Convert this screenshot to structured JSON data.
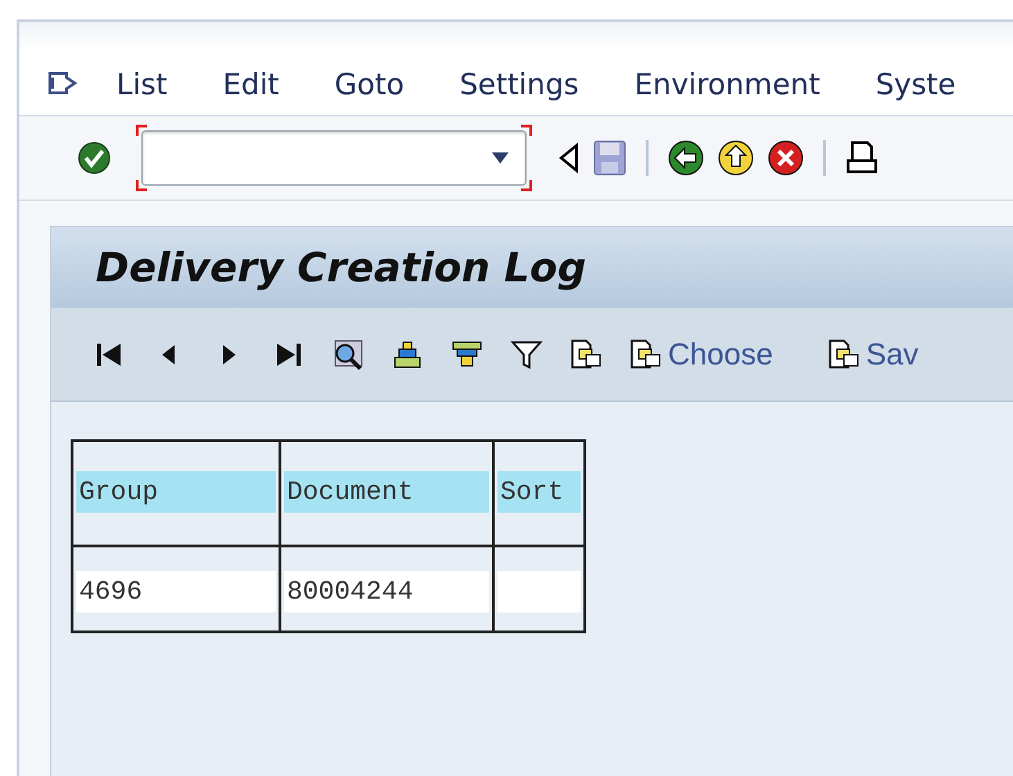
{
  "menu": [
    {
      "label": "List"
    },
    {
      "label": "Edit"
    },
    {
      "label": "Goto"
    },
    {
      "label": "Settings"
    },
    {
      "label": "Environment"
    },
    {
      "label": "Syste"
    }
  ],
  "screen": {
    "title": "Delivery Creation Log"
  },
  "app_toolbar": [
    {
      "kind": "first"
    },
    {
      "kind": "previous"
    },
    {
      "kind": "next"
    },
    {
      "kind": "last"
    },
    {
      "kind": "detail"
    },
    {
      "kind": "sort"
    },
    {
      "kind": "filter-set"
    },
    {
      "kind": "filter"
    },
    {
      "kind": "copy"
    },
    {
      "kind": "copy",
      "label": "Choose"
    },
    {
      "kind": "copy",
      "label": "Sav"
    }
  ],
  "table": {
    "columns": [
      "Group",
      "Document",
      "Sort"
    ],
    "rows": [
      [
        "4696",
        "80004244",
        ""
      ]
    ]
  }
}
